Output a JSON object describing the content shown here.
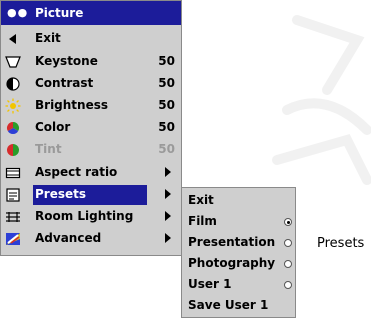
{
  "menu": {
    "header_title": "Picture",
    "items": [
      {
        "label": "Exit",
        "icon": "left-arrow-icon",
        "value": "",
        "has_submenu": false,
        "state": "normal"
      },
      {
        "label": "Keystone",
        "icon": "keystone-icon",
        "value": "50",
        "has_submenu": false,
        "state": "normal"
      },
      {
        "label": "Contrast",
        "icon": "contrast-icon",
        "value": "50",
        "has_submenu": false,
        "state": "normal"
      },
      {
        "label": "Brightness",
        "icon": "sun-icon",
        "value": "50",
        "has_submenu": false,
        "state": "normal"
      },
      {
        "label": "Color",
        "icon": "color-wheel-icon",
        "value": "50",
        "has_submenu": false,
        "state": "normal"
      },
      {
        "label": "Tint",
        "icon": "tint-icon",
        "value": "50",
        "has_submenu": false,
        "state": "disabled"
      },
      {
        "label": "Aspect ratio",
        "icon": "aspect-ratio-icon",
        "value": "",
        "has_submenu": true,
        "state": "normal"
      },
      {
        "label": "Presets",
        "icon": "presets-icon",
        "value": "",
        "has_submenu": true,
        "state": "selected"
      },
      {
        "label": "Room Lighting",
        "icon": "room-lighting-icon",
        "value": "",
        "has_submenu": true,
        "state": "normal"
      },
      {
        "label": "Advanced",
        "icon": "advanced-icon",
        "value": "",
        "has_submenu": true,
        "state": "normal"
      }
    ]
  },
  "submenu": {
    "items": [
      {
        "label": "Exit",
        "radio": "none"
      },
      {
        "label": "Film",
        "radio": "on"
      },
      {
        "label": "Presentation",
        "radio": "off"
      },
      {
        "label": "Photography",
        "radio": "off"
      },
      {
        "label": "User 1",
        "radio": "off"
      },
      {
        "label": "Save User 1",
        "radio": "none"
      }
    ]
  },
  "side_label": "Presets",
  "colors": {
    "highlight": "#1c1c9a",
    "menu_bg": "#cfcfcf",
    "disabled": "#9a9a9a"
  }
}
